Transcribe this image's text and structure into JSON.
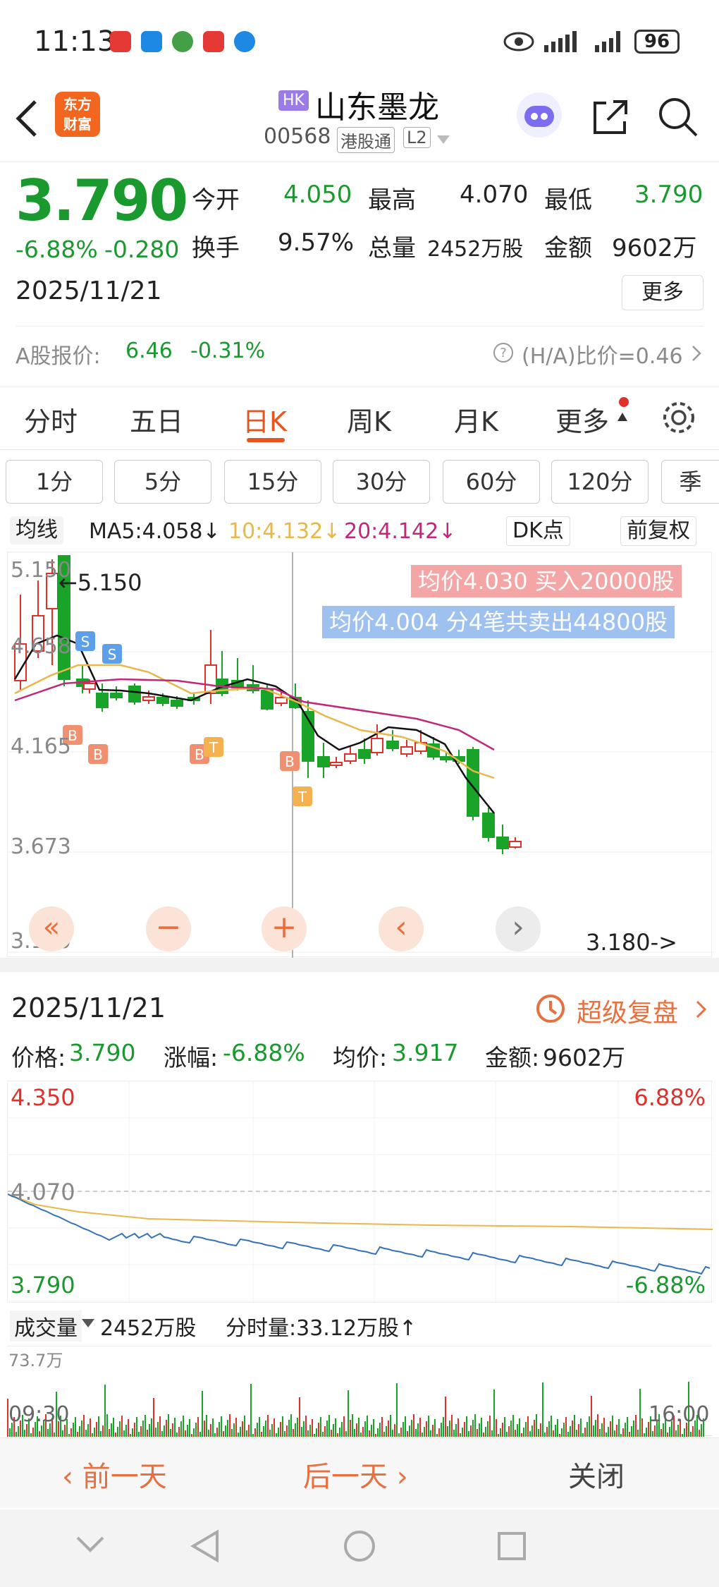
{
  "status_bar": {
    "time": "11:13",
    "battery": "96"
  },
  "header": {
    "logo_line1": "东方",
    "logo_line2": "财富",
    "market_badge": "HK",
    "stock_name": "山东墨龙",
    "stock_code": "00568",
    "tag_connect": "港股通",
    "tag_level": "L2"
  },
  "quote": {
    "price": "3.790",
    "change_pct": "-6.88%",
    "change_amt": "-0.280",
    "date": "2025/11/21",
    "open_label": "今开",
    "open": "4.050",
    "high_label": "最高",
    "high": "4.070",
    "low_label": "最低",
    "low": "3.790",
    "turnover_label": "换手",
    "turnover": "9.57%",
    "volume_label": "总量",
    "volume": "2452万股",
    "amount_label": "金额",
    "amount": "9602万",
    "more_label": "更多",
    "a_share_label": "A股报价:",
    "a_share_price": "6.46",
    "a_share_pct": "-0.31%",
    "ha_ratio": "(H/A)比价=0.46"
  },
  "tabs": [
    "分时",
    "五日",
    "日K",
    "周K",
    "月K",
    "更多"
  ],
  "active_tab": 2,
  "sub_tabs": [
    "1分",
    "5分",
    "15分",
    "30分",
    "60分",
    "120分",
    "季"
  ],
  "indicator": {
    "type": "均线",
    "ma5": "MA5:4.058↓",
    "ma10": "10:4.132↓",
    "ma20": "20:4.142↓",
    "dk": "DK点",
    "adjust": "前复权"
  },
  "kline": {
    "y_labels": [
      "5.150",
      "4.658",
      "4.165",
      "3.673",
      "3.180"
    ],
    "max_label": "←5.150",
    "min_label": "3.180->",
    "buy_banner": "均价4.030  买入20000股",
    "sell_banner": "均价4.004  分4笔共卖出44800股",
    "controls": [
      "«",
      "−",
      "+",
      "‹",
      "›"
    ],
    "colors": {
      "up": "#e0302b",
      "down": "#1aa329",
      "ma5": "#111111",
      "ma10": "#e8b84a",
      "ma20": "#c2277a"
    }
  },
  "detail": {
    "date": "2025/11/21",
    "replay": "超级复盘",
    "price_label": "价格:",
    "price": "3.790",
    "chg_label": "涨幅:",
    "chg": "-6.88%",
    "avg_label": "均价:",
    "avg": "3.917",
    "amt_label": "金额:",
    "amt": "9602万"
  },
  "timeshare": {
    "top_price": "4.350",
    "top_pct": "6.88%",
    "mid_price": "4.070",
    "bottom_price": "3.790",
    "bottom_pct": "-6.88%"
  },
  "volume": {
    "label": "成交量",
    "total": "2452万股",
    "tick_vol": "分时量:33.12万股↑",
    "max": "73.7万",
    "start": "09:30",
    "end": "16:00"
  },
  "bottom": {
    "prev": "前一天",
    "next": "后一天",
    "close": "关闭"
  }
}
